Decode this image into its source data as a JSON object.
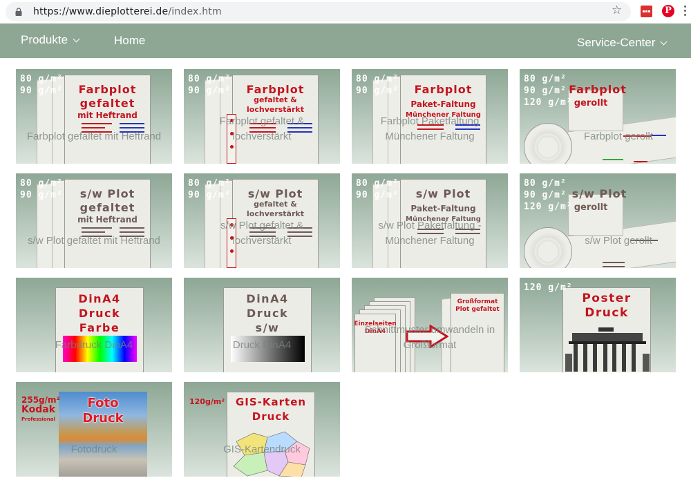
{
  "browser": {
    "url_host": "https://www.dieplotterei.de",
    "url_path": "/index.htm"
  },
  "nav": {
    "produkte": "Produkte",
    "home": "Home",
    "service": "Service-Center"
  },
  "tiles": [
    {
      "weights": [
        "80 g/m²",
        "90 g/m²"
      ],
      "title": [
        "Farbplot",
        "gefaltet"
      ],
      "sub": "mit Heftrand",
      "caption": "Farbplot gefaltet mit Heftrand"
    },
    {
      "weights": [
        "80 g/m²",
        "90 g/m²"
      ],
      "title": [
        "Farbplot"
      ],
      "sub": [
        "gefaltet &",
        "lochverstärkt"
      ],
      "caption": [
        "Farbplot gefaltet &",
        "lochverstärkt"
      ]
    },
    {
      "weights": [
        "80 g/m²",
        "90 g/m²"
      ],
      "title": [
        "Farbplot"
      ],
      "sub": [
        "Paket-Faltung",
        "Münchener Faltung"
      ],
      "caption": [
        "Farbplot Paketfaltung",
        "Münchener Faltung"
      ]
    },
    {
      "weights": [
        "80 g/m²",
        "90 g/m²",
        "120 g/m²"
      ],
      "title": [
        "Farbplot"
      ],
      "sub": "gerollt",
      "caption": "Farbplot gerollt"
    },
    {
      "weights": [
        "80 g/m²",
        "90 g/m²"
      ],
      "title": [
        "s/w Plot",
        "gefaltet"
      ],
      "sub": "mit Heftrand",
      "caption": "s/w Plot gefaltet mit Heftrand"
    },
    {
      "weights": [
        "80 g/m²",
        "90 g/m²"
      ],
      "title": [
        "s/w Plot"
      ],
      "sub": [
        "gefaltet &",
        "lochverstärkt"
      ],
      "caption": [
        "s/w Plot gefaltet &",
        "lochverstärkt"
      ]
    },
    {
      "weights": [
        "80 g/m²",
        "90 g/m²"
      ],
      "title": [
        "s/w Plot"
      ],
      "sub": [
        "Paket-Faltung",
        "Münchener Faltung"
      ],
      "caption": [
        "s/w Plot Paketfaltung -",
        "Münchener Faltung"
      ]
    },
    {
      "weights": [
        "80 g/m²",
        "90 g/m²",
        "120 g/m²"
      ],
      "title": [
        "s/w Plot"
      ],
      "sub": "gerollt",
      "caption": "s/w Plot gerollt"
    },
    {
      "title": [
        "DinA4",
        "Druck",
        "Farbe"
      ],
      "caption": "Farbdruck DinA4"
    },
    {
      "title": [
        "DinA4",
        "Druck",
        "s/w"
      ],
      "caption": "Druck DinA4"
    },
    {
      "left_label": [
        "Einzelseiten",
        "DinA4"
      ],
      "right_label": [
        "Großformat",
        "Plot gefaltet"
      ],
      "caption": [
        "Schnittmuster umwandeln in",
        "Großformat"
      ]
    },
    {
      "weights": [
        "120 g/m²"
      ],
      "title": [
        "Poster",
        "Druck"
      ]
    },
    {
      "weights": [
        "255g/m²",
        "Kodak",
        "Professional"
      ],
      "title": [
        "Foto",
        "Druck"
      ],
      "caption": "Fotodruck"
    },
    {
      "weights": [
        "120g/m²"
      ],
      "title": [
        "GIS-Karten",
        "Druck"
      ],
      "caption": "GIS-Kartendruck"
    }
  ],
  "colors": {
    "nav_bg": "#8ea795",
    "title_red": "#c4141f",
    "title_brown": "#6e5a55"
  }
}
